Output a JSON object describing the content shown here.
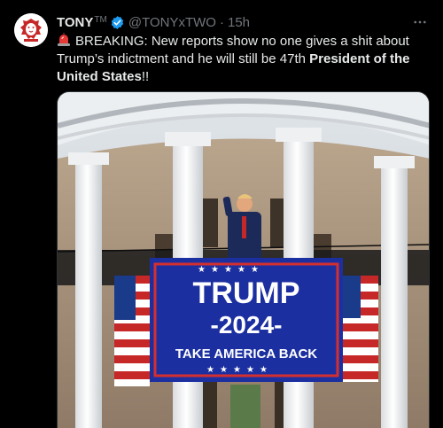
{
  "tweet": {
    "display_name": "TONY",
    "trademark": "TM",
    "handle": "@TONYxTWO",
    "separator": "·",
    "time": "15h",
    "text_main": "BREAKING: New reports show no one gives a shit about Trump’s indictment and he will still be 47th ",
    "text_bold": "President of the United States",
    "text_end": "!!",
    "icons": {
      "avatar": "lion-logo",
      "verified": "verified-badge-icon",
      "more": "more-options-icon",
      "siren": "siren-emoji-icon"
    },
    "colors": {
      "background": "#000000",
      "text": "#e7e9ea",
      "muted": "#71767b",
      "verified": "#1d9bf0"
    }
  },
  "media": {
    "description_icon": "white-house-trump-banner-image",
    "banner": {
      "line1": "TRUMP",
      "line2": "-2024-",
      "line3": "TAKE AMERICA BACK"
    }
  }
}
